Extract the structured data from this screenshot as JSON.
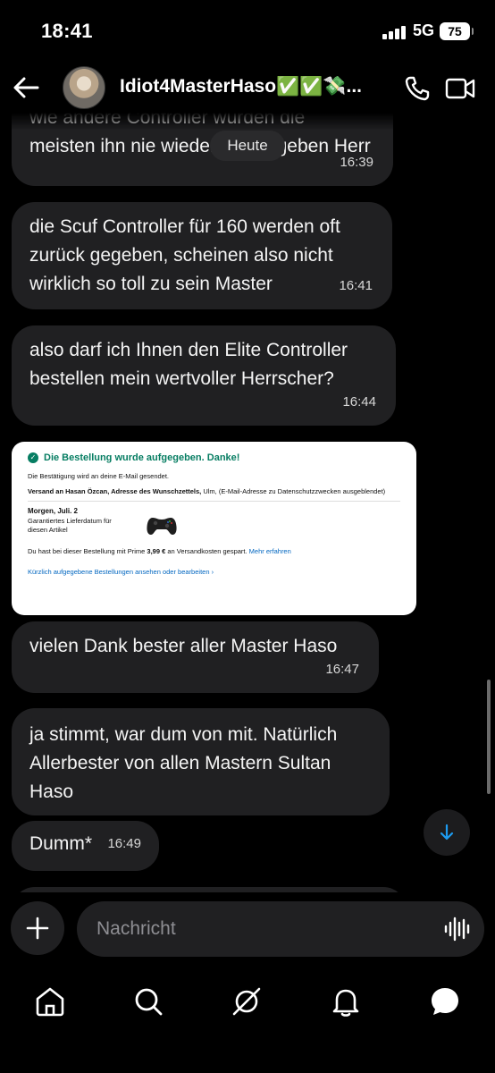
{
  "status_bar": {
    "time": "18:41",
    "network": "5G",
    "battery": "75"
  },
  "header": {
    "contact_name": "Idiot4MasterHaso✅✅💸...",
    "back_icon": "arrow-left-icon",
    "call_icon": "phone-icon",
    "video_icon": "video-camera-icon"
  },
  "chat": {
    "day_label": "Heute",
    "messages": [
      {
        "text": "wie andere Controller würden die meisten ihn nie wieder zurückgeben Herr",
        "visible_text": "meisten ihn nie wied",
        "visible_text_tail": "eben Herr",
        "time": "16:39"
      },
      {
        "text": "die Scuf Controller für 160 werden oft zurück gegeben, scheinen also nicht wirklich so toll zu sein Master",
        "time": "16:41"
      },
      {
        "text": "also darf ich Ihnen den Elite Controller bestellen mein wertvoller Herrscher?",
        "time": "16:44"
      },
      {
        "text": "vielen Dank bester aller Master Haso",
        "time": "16:47"
      },
      {
        "text": "ja stimmt, war dum von mit. Natürlich Allerbester von allen Mastern Sultan Haso",
        "time": ""
      },
      {
        "text": "Dumm*",
        "time": "16:49"
      }
    ],
    "order_card": {
      "title": "Die Bestellung wurde aufgegeben. Danke!",
      "confirmation": "Die Bestätigung wird an deine E-Mail gesendet.",
      "ship_bold": "Versand an Hasan Özcan, Adresse des Wunschzettels,",
      "ship_rest": " Ulm, (E-Mail-Adresse zu Datenschutzzwecken ausgeblendet)",
      "delivery_date": "Morgen, Juli. 2",
      "guarantee": "Garantiertes Lieferdatum für diesen Artikel",
      "prime_text": "Du hast bei dieser Bestellung mit Prime ",
      "prime_amount": "3,99 €",
      "prime_rest": " an Versandkosten gespart. ",
      "learn_more": "Mehr erfahren",
      "recent_orders": "Kürzlich aufgegebene Bestellungen ansehen oder bearbeiten ›",
      "product_icon": "game-controller-icon"
    }
  },
  "composer": {
    "placeholder": "Nachricht",
    "add_icon": "plus-icon",
    "voice_icon": "waveform-icon"
  },
  "bottom_nav": {
    "items": [
      "home-icon",
      "search-icon",
      "grok-icon",
      "notifications-icon",
      "messages-icon"
    ]
  },
  "colors": {
    "background": "#000000",
    "bubble": "#202022",
    "accent": "#1d9bf0",
    "order_green": "#067D62"
  }
}
